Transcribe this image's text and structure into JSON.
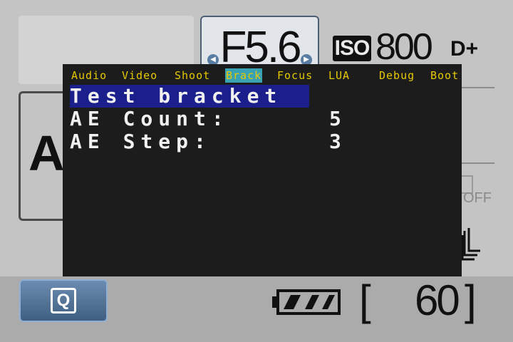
{
  "camera": {
    "aperture": "F5.6",
    "iso_label": "ISO",
    "iso_value": "800",
    "d_plus": "D+",
    "mode": "A",
    "off_label": "OFF",
    "q_button_label": "Q",
    "shots_open": "[",
    "shots_remaining": "60",
    "shots_close": "]"
  },
  "menu": {
    "tabs": [
      {
        "label": "Audio",
        "active": false
      },
      {
        "label": "Video",
        "active": false
      },
      {
        "label": "Shoot",
        "active": false
      },
      {
        "label": "Brack",
        "active": true
      },
      {
        "label": "Focus",
        "active": false
      },
      {
        "label": "LUA",
        "active": false
      },
      {
        "label": "Debug",
        "active": false
      },
      {
        "label": "Boot",
        "active": false
      }
    ],
    "items": [
      {
        "label": "Test bracket",
        "value": "",
        "selected": true
      },
      {
        "label": "AE Count:",
        "value": "5",
        "selected": false
      },
      {
        "label": "AE Step:",
        "value": "3",
        "selected": false
      }
    ]
  },
  "colors": {
    "menu_bg": "#1c1c1c",
    "tab_text": "#e6c800",
    "tab_active_bg": "#39a3b4",
    "selected_item_bg": "#1a1f8c",
    "q_button": "#4f6f93"
  }
}
